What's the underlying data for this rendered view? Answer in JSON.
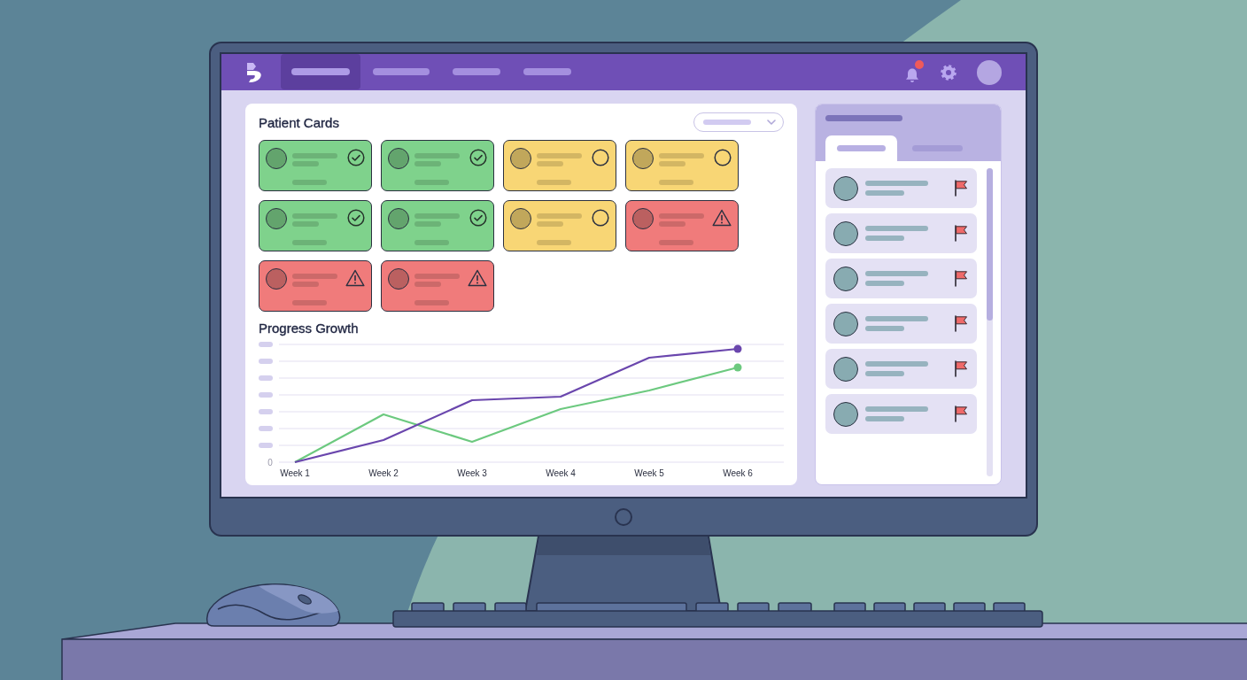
{
  "navbar": {
    "tabs": [
      {
        "selected": true
      },
      {
        "selected": false
      },
      {
        "selected": false
      },
      {
        "selected": false
      }
    ],
    "notifications": {
      "unread": true
    }
  },
  "patient_cards": {
    "title": "Patient Cards",
    "cards": [
      {
        "kind": "done",
        "color": "#7fd28c"
      },
      {
        "kind": "done",
        "color": "#7fd28c"
      },
      {
        "kind": "pending",
        "color": "#f8d675"
      },
      {
        "kind": "pending",
        "color": "#f8d675"
      },
      {
        "kind": "done",
        "color": "#7fd28c"
      },
      {
        "kind": "done",
        "color": "#7fd28c"
      },
      {
        "kind": "pending",
        "color": "#f8d675"
      },
      {
        "kind": "warning",
        "color": "#f07b7b"
      },
      {
        "kind": "warning",
        "color": "#f07b7b"
      },
      {
        "kind": "warning",
        "color": "#f07b7b"
      }
    ]
  },
  "progress_growth": {
    "title": "Progress Growth",
    "y_tick_labels": [
      "0"
    ],
    "x_labels": [
      "Week 1",
      "Week 2",
      "Week 3",
      "Week 4",
      "Week 5",
      "Week 6"
    ],
    "series": [
      {
        "color": "#6a46ad"
      },
      {
        "color": "#6cc97f"
      }
    ]
  },
  "side_panel": {
    "tabs": [
      {
        "selected": true
      },
      {
        "selected": false
      }
    ],
    "items": [
      {
        "flagged": true
      },
      {
        "flagged": true
      },
      {
        "flagged": true
      },
      {
        "flagged": true
      },
      {
        "flagged": true
      },
      {
        "flagged": true
      }
    ]
  }
}
